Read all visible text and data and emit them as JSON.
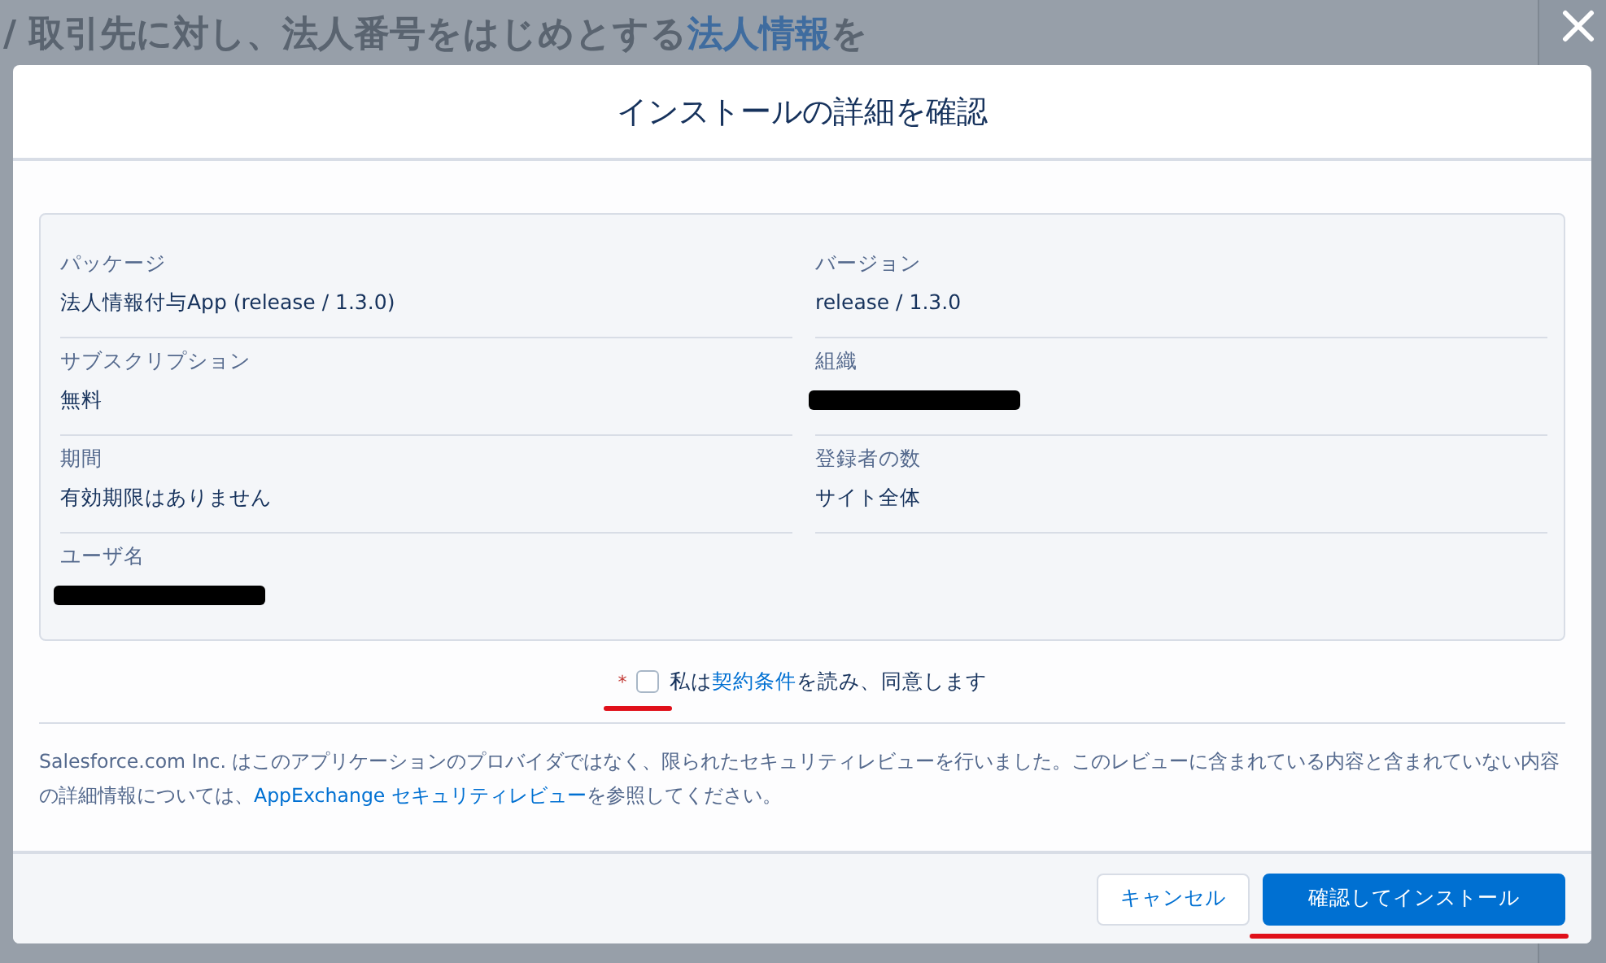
{
  "background_heading": [
    {
      "kind": "text",
      "text": "/ 取引先に対し、法人番号をはじめとする"
    },
    {
      "kind": "link",
      "text": "法人情報"
    },
    {
      "kind": "text",
      "text": "を"
    }
  ],
  "modal": {
    "title": "インストールの詳細を確認",
    "details": [
      {
        "label": "パッケージ",
        "kind": "text",
        "value": "法人情報付与App (release / 1.3.0)"
      },
      {
        "label": "バージョン",
        "kind": "text",
        "value": "release / 1.3.0"
      },
      {
        "label": "サブスクリプション",
        "kind": "text",
        "value": "無料"
      },
      {
        "label": "組織",
        "kind": "redacted"
      },
      {
        "label": "期間",
        "kind": "text",
        "value": "有効期限はありません"
      },
      {
        "label": "登録者の数",
        "kind": "text",
        "value": "サイト全体"
      },
      {
        "label": "ユーザ名",
        "kind": "redacted"
      }
    ],
    "agreement": {
      "required_mark": "*",
      "checked": false,
      "parts": [
        {
          "kind": "text",
          "text": "私は"
        },
        {
          "kind": "link",
          "text": "契約条件"
        },
        {
          "kind": "text",
          "text": "を読み、同意します"
        }
      ]
    },
    "disclaimer": [
      {
        "kind": "text",
        "text": "Salesforce.com Inc. はこのアプリケーションのプロバイダではなく、限られたセキュリティレビューを行いました。このレビューに含まれている内容と含まれていない内容の詳細情報については、"
      },
      {
        "kind": "link",
        "text": "AppExchange セキュリティレビュー"
      },
      {
        "kind": "text",
        "text": "を参照してください。"
      }
    ],
    "buttons": [
      {
        "label": "キャンセル",
        "kind": "neutral"
      },
      {
        "label": "確認してインストール",
        "kind": "brand"
      }
    ]
  }
}
